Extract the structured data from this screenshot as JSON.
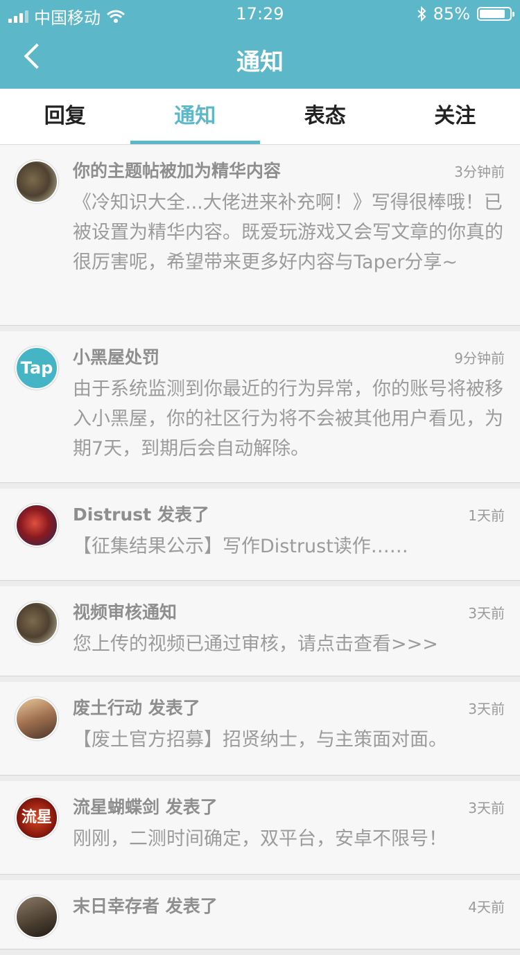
{
  "status": {
    "carrier": "中国移动",
    "time": "17:29",
    "battery": "85%",
    "battery_level": 0.85
  },
  "nav": {
    "title": "通知"
  },
  "tabs": [
    {
      "label": "回复",
      "active": false
    },
    {
      "label": "通知",
      "active": true
    },
    {
      "label": "表态",
      "active": false
    },
    {
      "label": "关注",
      "active": false
    }
  ],
  "notifications": [
    {
      "title": "你的主题帖被加为精华内容",
      "time": "3分钟前",
      "body": "《冷知识大全...大佬进来补充啊！》写得很棒哦！已被设置为精华内容。既爱玩游戏又会写文章的你真的很厉害呢，希望带来更多好内容与Taper分享~",
      "avatar": "soldier-dog-avatar"
    },
    {
      "title": "小黑屋处罚",
      "time": "9分钟前",
      "body": "由于系统监测到你最近的行为异常，你的账号将被移入小黑屋，你的社区行为将不会被其他用户看见，为期7天，到期后会自动解除。",
      "avatar": "taptap-logo-avatar",
      "avatar_text": "Tap"
    },
    {
      "title": "Distrust 发表了",
      "time": "1天前",
      "body": "【征集结果公示】写作Distrust读作……",
      "avatar": "distrust-avatar"
    },
    {
      "title": "视频审核通知",
      "time": "3天前",
      "body": "您上传的视频已通过审核，请点击查看>>>",
      "avatar": "soldier-dog-avatar"
    },
    {
      "title": "废土行动 发表了",
      "time": "3天前",
      "body": "【废土官方招募】招贤纳士，与主策面对面。",
      "avatar": "wasteland-avatar"
    },
    {
      "title": "流星蝴蝶剑 发表了",
      "time": "3天前",
      "body": "刚刚，二测时间确定，双平台，安卓不限号！",
      "avatar": "meteor-sword-avatar",
      "avatar_text": "流星"
    },
    {
      "title": "末日幸存者 发表了",
      "time": "4天前",
      "body": "",
      "avatar": "doomsday-survivor-avatar"
    }
  ]
}
